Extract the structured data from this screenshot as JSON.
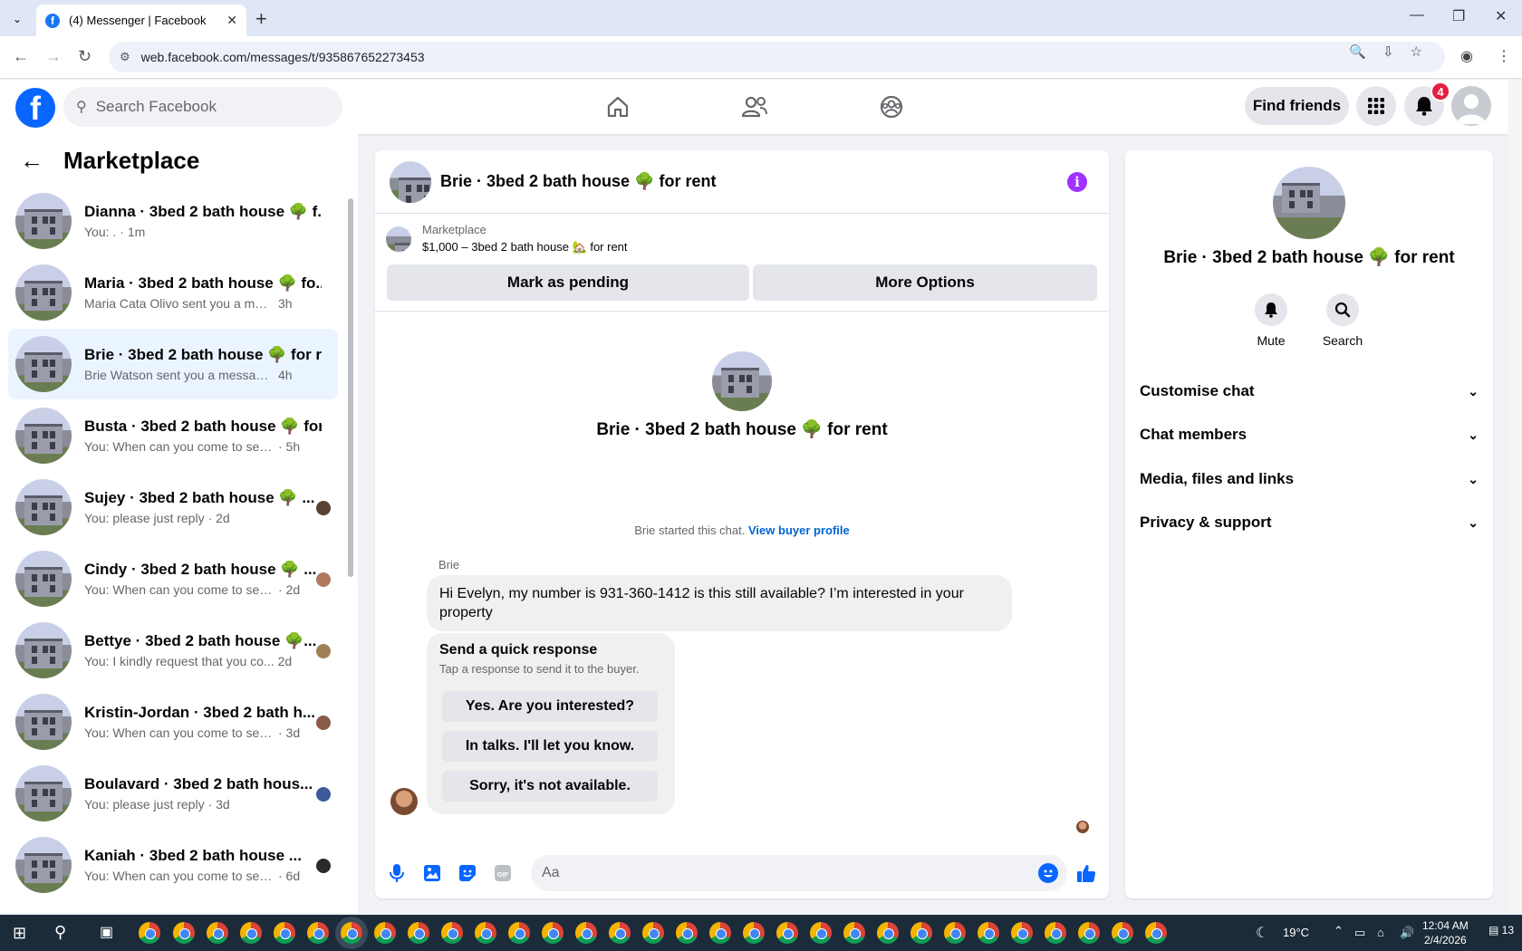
{
  "browser": {
    "tab_title": "(4) Messenger | Facebook",
    "url": "web.facebook.com/messages/t/935867652273453"
  },
  "header": {
    "search_placeholder": "Search Facebook",
    "find_friends": "Find friends",
    "notification_count": "4"
  },
  "sidebar": {
    "title": "Marketplace",
    "conversations": [
      {
        "name": "Dianna · 3bed 2 bath house 🌳 f...",
        "snippet": "You: .",
        "time": "· 1m"
      },
      {
        "name": "Maria · 3bed 2 bath house 🌳 fo...",
        "snippet": "Maria Cata Olivo sent you a messag...",
        "time": "3h"
      },
      {
        "name": "Brie · 3bed 2 bath house 🌳 for r...",
        "snippet": "Brie Watson sent you a message ab...",
        "time": "4h"
      },
      {
        "name": "Busta · 3bed 2 bath house 🌳 for...",
        "snippet": "You: When can you come to see th...",
        "time": "· 5h"
      },
      {
        "name": "Sujey · 3bed 2 bath house 🌳 ...",
        "snippet": "You: please just reply",
        "time": "· 2d"
      },
      {
        "name": "Cindy · 3bed 2 bath house 🌳 ...",
        "snippet": "You: When can you come to see ...",
        "time": "· 2d"
      },
      {
        "name": "Bettye · 3bed 2 bath house 🌳...",
        "snippet": "You: I kindly request that you co...",
        "time": "2d"
      },
      {
        "name": "Kristin-Jordan · 3bed 2 bath h...",
        "snippet": "You: When can you come to see ...",
        "time": "· 3d"
      },
      {
        "name": "Boulavard · 3bed 2 bath hous...",
        "snippet": "You: please just reply",
        "time": "· 3d"
      },
      {
        "name": "Kaniah · 3bed 2 bath house ...",
        "snippet": "You: When can you come to see ...",
        "time": "· 6d"
      }
    ]
  },
  "chat": {
    "title": "Brie · 3bed 2 bath house 🌳 for rent",
    "listing_label": "Marketplace",
    "listing_price": "$1,000 – 3bed 2 bath house 🏡 for rent",
    "mark_pending": "Mark as pending",
    "more_options": "More Options",
    "big_name": "Brie · 3bed 2 bath house 🌳 for rent",
    "started_text": "Brie started this chat.",
    "view_profile": "View buyer profile",
    "sender": "Brie",
    "message": "Hi Evelyn, my number is 931-360-1412 is this still available? I’m interested in your property",
    "quick_title": "Send a quick response",
    "quick_sub": "Tap a response to send it to the buyer.",
    "quick_replies": [
      "Yes. Are you interested?",
      "In talks. I'll let you know.",
      "Sorry, it's not available."
    ],
    "input_placeholder": "Aa"
  },
  "details": {
    "name": "Brie · 3bed 2 bath house 🌳 for rent",
    "mute": "Mute",
    "search": "Search",
    "sections": [
      "Customise chat",
      "Chat members",
      "Media, files and links",
      "Privacy & support"
    ]
  },
  "taskbar": {
    "temperature": "19°C",
    "time": "12:04 AM",
    "date": "2/4/2026",
    "notif_count": "13"
  },
  "colors": {
    "fb_blue": "#0866ff",
    "messenger_purple": "#a033ff",
    "active_convo": "#ebf5ff"
  }
}
